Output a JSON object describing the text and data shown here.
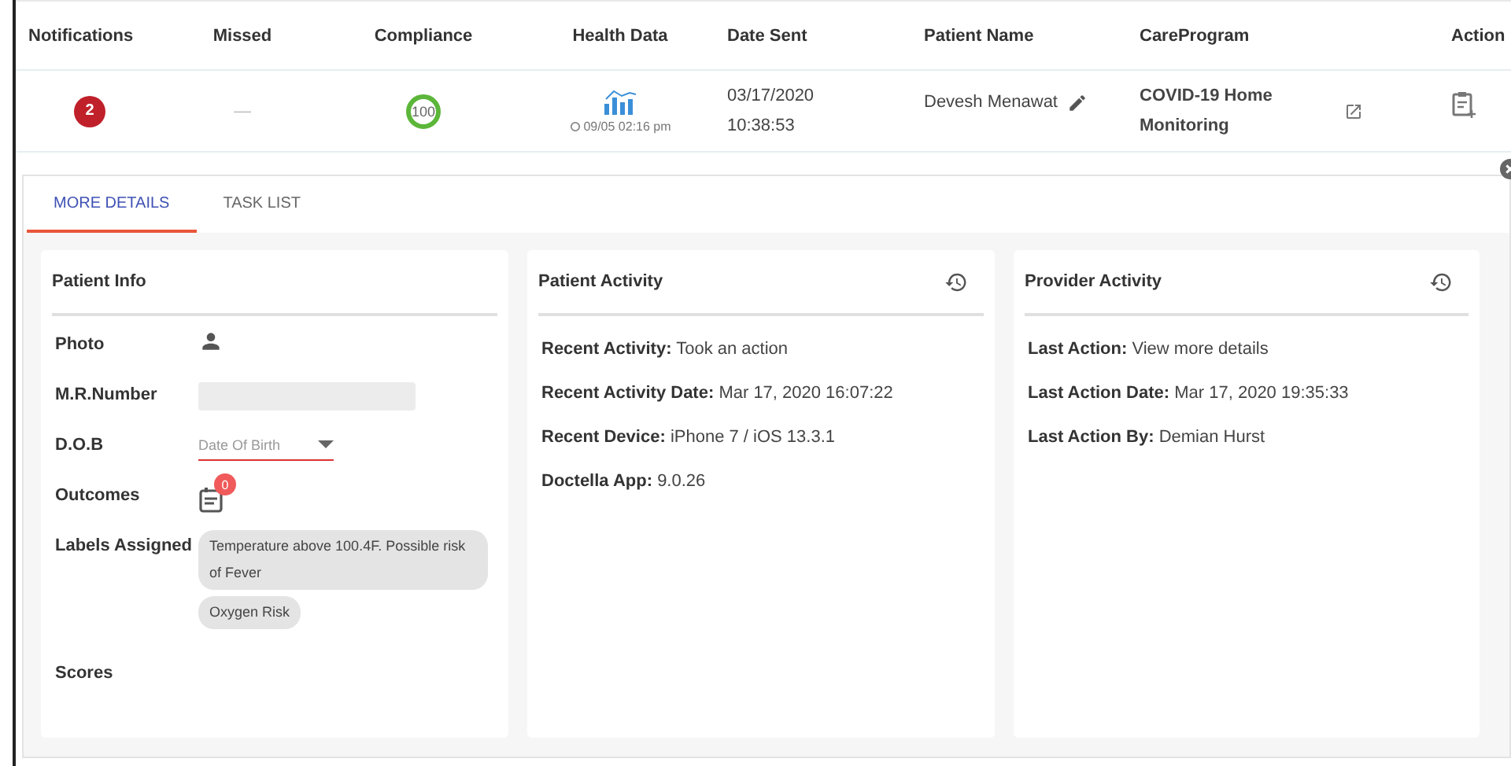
{
  "table": {
    "columns": [
      "Notifications",
      "Missed",
      "Compliance",
      "Health Data",
      "Date Sent",
      "Patient Name",
      "CareProgram",
      "Action"
    ],
    "row": {
      "notifications": "2",
      "missed": "—",
      "compliance": "100",
      "health_time": "09/05 02:16 pm",
      "date_sent": [
        "03/17/2020",
        "10:38:53"
      ],
      "patient_name": "Devesh Menawat",
      "care_program": "COVID-19 Home Monitoring"
    }
  },
  "details": {
    "tabs": [
      {
        "label": "MORE DETAILS",
        "selected": true
      },
      {
        "label": "TASK LIST",
        "selected": false
      }
    ],
    "patient_info": {
      "title": "Patient Info",
      "fields": [
        {
          "kind": "photo",
          "label": "Photo"
        },
        {
          "kind": "field",
          "label": "M.R.Number"
        },
        {
          "kind": "date",
          "label": "D.O.B",
          "placeholder": "Date Of Birth"
        },
        {
          "kind": "outcomes",
          "label": "Outcomes",
          "count": "0"
        },
        {
          "kind": "labels",
          "label": "Labels Assigned",
          "chips": [
            "Temperature above 100.4F. Possible risk of Fever",
            "Oxygen Risk"
          ]
        },
        {
          "kind": "empty",
          "label": "Scores"
        }
      ]
    },
    "activity_cards": [
      {
        "title": "Patient Activity",
        "lines": [
          {
            "label": "Recent Activity:",
            "value": "Took an action"
          },
          {
            "label": "Recent Activity Date:",
            "value": "Mar 17, 2020 16:07:22"
          },
          {
            "label": "Recent Device:",
            "value": "iPhone 7 / iOS 13.3.1"
          },
          {
            "label": "Doctella App:",
            "value": "9.0.26"
          }
        ]
      },
      {
        "title": "Provider Activity",
        "lines": [
          {
            "label": "Last Action:",
            "value": "View more details"
          },
          {
            "label": "Last Action Date:",
            "value": "Mar 17, 2020 19:35:33"
          },
          {
            "label": "Last Action By:",
            "value": "Demian Hurst"
          }
        ]
      }
    ]
  }
}
